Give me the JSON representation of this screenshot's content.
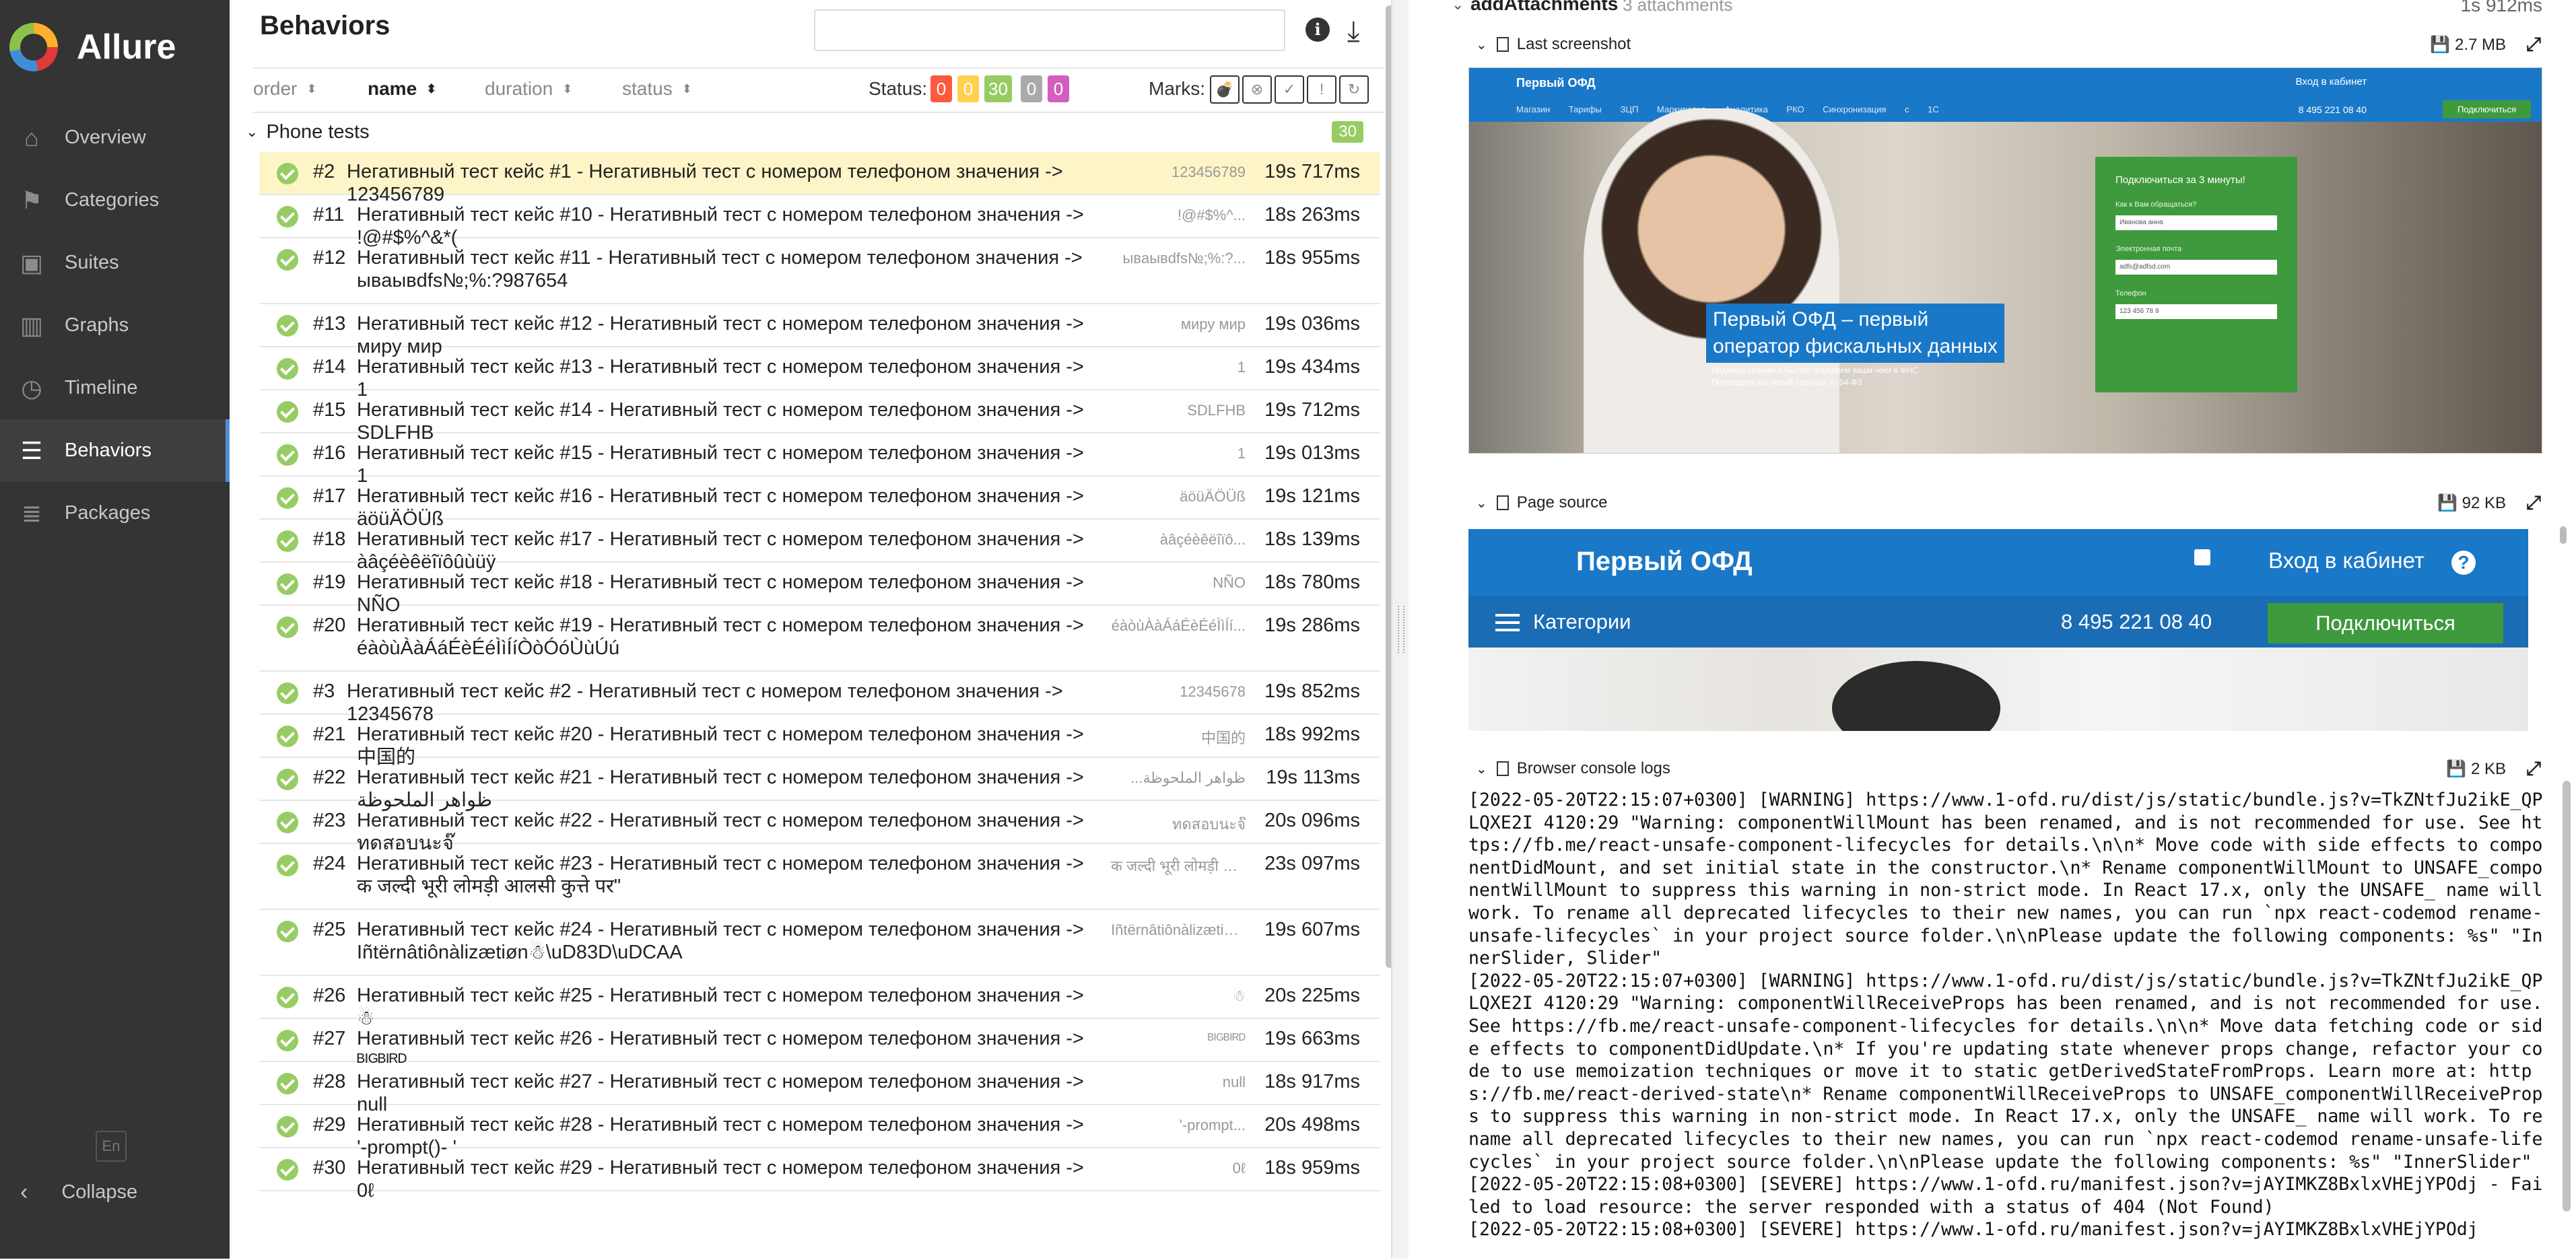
{
  "app": {
    "name": "Allure"
  },
  "sidebar": {
    "items": [
      {
        "label": "Overview",
        "icon": "home-icon"
      },
      {
        "label": "Categories",
        "icon": "flag-icon"
      },
      {
        "label": "Suites",
        "icon": "briefcase-icon"
      },
      {
        "label": "Graphs",
        "icon": "bar-chart-icon"
      },
      {
        "label": "Timeline",
        "icon": "clock-icon"
      },
      {
        "label": "Behaviors",
        "icon": "list-icon",
        "active": true
      },
      {
        "label": "Packages",
        "icon": "stack-icon"
      }
    ],
    "lang": "En",
    "collapse": "Collapse"
  },
  "tree": {
    "title": "Behaviors",
    "search_placeholder": "",
    "sort": [
      "order",
      "name",
      "duration",
      "status"
    ],
    "status_label": "Status:",
    "status_counts": [
      {
        "value": "0",
        "color": "#fd5a3e"
      },
      {
        "value": "0",
        "color": "#ffd050"
      },
      {
        "value": "30",
        "color": "#97cc64"
      },
      {
        "value": "0",
        "color": "#aaaaaa"
      },
      {
        "value": "0",
        "color": "#d35ebe"
      }
    ],
    "marks_label": "Marks:",
    "group": {
      "name": "Phone tests",
      "count": "30"
    },
    "rows": [
      {
        "num": "#2",
        "name": "Негативный тест кейс #1 - Негативный тест с номером телефоном значения -> 123456789",
        "param": "123456789",
        "dur": "19s 717ms",
        "selected": true
      },
      {
        "num": "#11",
        "name": "Негативный тест кейс #10 - Негативный тест с номером телефоном значения -> !@#$%^&*(",
        "param": "!@#$%^...",
        "dur": "18s 263ms"
      },
      {
        "num": "#12",
        "name": "Негативный тест кейс #11 - Негативный тест с номером телефоном значения -> ывaывdfs№;%:?987654",
        "param": "ывaывdfs№;%:?...",
        "dur": "18s 955ms"
      },
      {
        "num": "#13",
        "name": "Негативный тест кейс #12 - Негативный тест с номером телефоном значения -> миру мир",
        "param": "миру мир",
        "dur": "19s 036ms"
      },
      {
        "num": "#14",
        "name": "Негативный тест кейс #13 - Негативный тест с номером телефоном значения -> 1",
        "param": "1",
        "dur": "19s 434ms"
      },
      {
        "num": "#15",
        "name": "Негативный тест кейс #14 - Негативный тест с номером телефоном значения -> SDLFHB",
        "param": "SDLFHB",
        "dur": "19s 712ms"
      },
      {
        "num": "#16",
        "name": "Негативный тест кейс #15 - Негативный тест с номером телефоном значения -> 1",
        "param": "1",
        "dur": "19s 013ms"
      },
      {
        "num": "#17",
        "name": "Негативный тест кейс #16 - Негативный тест с номером телефоном значения -> äöüÄÖÜß",
        "param": "äöüÄÖÜß",
        "dur": "19s 121ms"
      },
      {
        "num": "#18",
        "name": "Негативный тест кейс #17 - Негативный тест с номером телефоном значения -> àâçéèêëîïôûùüÿ",
        "param": "àâçéèêëîïô...",
        "dur": "18s 139ms"
      },
      {
        "num": "#19",
        "name": "Негативный тест кейс #18 - Негативный тест с номером телефоном значения -> NÑO",
        "param": "NÑO",
        "dur": "18s 780ms"
      },
      {
        "num": "#20",
        "name": "Негативный тест кейс #19 - Негативный тест с номером телефоном значения -> éàòùÀàÁáÉèÉéÌìÍíÒòÓóÙùÚú",
        "param": "éàòùÀàÁáÉèÉéÌìÍí...",
        "dur": "19s 286ms"
      },
      {
        "num": "#3",
        "name": "Негативный тест кейс #2 - Негативный тест с номером телефоном значения -> 12345678",
        "param": "12345678",
        "dur": "19s 852ms"
      },
      {
        "num": "#21",
        "name": "Негативный тест кейс #20 - Негативный тест с номером телефоном значения -> 中国的",
        "param": "中国的",
        "dur": "18s 992ms"
      },
      {
        "num": "#22",
        "name": "Негативный тест кейс #21 - Негативный тест с номером телефоном значения -> ظواهر الملحوظة",
        "param": "...ظواهر الملحوظة",
        "dur": "19s 113ms"
      },
      {
        "num": "#23",
        "name": "Негативный тест кейс #22 - Негативный тест с номером телефоном значения -> ทดสอบนะจ๊",
        "param": "ทดสอบนะจ๊",
        "dur": "20s 096ms"
      },
      {
        "num": "#24",
        "name": "Негативный тест кейс #23 - Негативный тест с номером телефоном значения -> क जल्दी भूरी लोमड़ी आलसी कुत्ते पर\"",
        "param": "क जल्दी भूरी लोमड़ी आ...",
        "dur": "23s 097ms"
      },
      {
        "num": "#25",
        "name": "Негативный тест кейс #24 - Негативный тест с номером телефоном значения -> Iñtërnâtiônàlizætiøn☃\\uD83D\\uDCAA",
        "param": "Iñtërnâtiônàlizætiøn☃\\...",
        "dur": "19s 607ms"
      },
      {
        "num": "#26",
        "name": "Негативный тест кейс #25 - Негативный тест с номером телефоном значения -> ☃",
        "param": "☃",
        "dur": "20s 225ms"
      },
      {
        "num": "#27",
        "name": "Негативный тест кейс #26 - Негативный тест с номером телефоном значения -> ᴮᴵᴳᴮᴵᴿᴰ",
        "param": "ᴮᴵᴳᴮᴵᴿᴰ",
        "dur": "19s 663ms"
      },
      {
        "num": "#28",
        "name": "Негативный тест кейс #27 - Негативный тест с номером телефоном значения -> null",
        "param": "null",
        "dur": "18s 917ms"
      },
      {
        "num": "#29",
        "name": "Негативный тест кейс #28 - Негативный тест с номером телефоном значения -> '-prompt()- '",
        "param": "'-prompt...",
        "dur": "20s 498ms"
      },
      {
        "num": "#30",
        "name": "Негативный тест кейс #29 - Негативный тест с номером телефоном значения -> 0ℓ",
        "param": "0ℓ",
        "dur": "18s 959ms"
      }
    ]
  },
  "detail": {
    "step_title": "addAttachments",
    "step_count": "3 attachments",
    "step_time": "1s 912ms",
    "attachments": [
      {
        "name": "Last screenshot",
        "size": "2.7 MB"
      },
      {
        "name": "Page source",
        "size": "92 KB"
      },
      {
        "name": "Browser console logs",
        "size": "2 KB"
      }
    ],
    "screenshot": {
      "brand": "Первый ОФД",
      "login": "Вход в кабинет",
      "menu": "Магазин Тарифы ЗЦП Маркировка Аналитика РКО Синхронизация с 1С",
      "phone": "8 495 221 08 40",
      "connect": "Подключиться",
      "hero_line1": "Первый ОФД – первый",
      "hero_line2": "оператор фискальных данных",
      "sub_line1": "Надежно храним и быстро передаем ваши чеки в ФНС.",
      "sub_line2": "Переходите на новый порядок по 54-ФЗ",
      "form_title": "Подключиться за 3 минуты!",
      "form_q1": "Как к Вам обращаться?",
      "form_v1": "Иванова анна",
      "form_q2": "Электронная почта",
      "form_v2": "adfs@adfsd.com",
      "form_q3": "Телефон",
      "form_v3": "123 456 78 9"
    },
    "source": {
      "brand": "Первый ОФД",
      "login": "Вход в кабинет",
      "help": "?",
      "categories": "Категории",
      "phone": "8 495 221 08 40",
      "connect": "Подключиться"
    },
    "console_log": "[2022-05-20T22:15:07+0300] [WARNING] https://www.1-ofd.ru/dist/js/static/bundle.js?v=TkZNtfJu2ikE_QPLQXE2I 4120:29 \"Warning: componentWillMount has been renamed, and is not recommended for use. See https://fb.me/react-unsafe-component-lifecycles for details.\\n\\n* Move code with side effects to componentDidMount, and set initial state in the constructor.\\n* Rename componentWillMount to UNSAFE_componentWillMount to suppress this warning in non-strict mode. In React 17.x, only the UNSAFE_ name will work. To rename all deprecated lifecycles to their new names, you can run `npx react-codemod rename-unsafe-lifecycles` in your project source folder.\\n\\nPlease update the following components: %s\" \"InnerSlider, Slider\"\n[2022-05-20T22:15:07+0300] [WARNING] https://www.1-ofd.ru/dist/js/static/bundle.js?v=TkZNtfJu2ikE_QPLQXE2I 4120:29 \"Warning: componentWillReceiveProps has been renamed, and is not recommended for use. See https://fb.me/react-unsafe-component-lifecycles for details.\\n\\n* Move data fetching code or side effects to componentDidUpdate.\\n* If you're updating state whenever props change, refactor your code to use memoization techniques or move it to static getDerivedStateFromProps. Learn more at: https://fb.me/react-derived-state\\n* Rename componentWillReceiveProps to UNSAFE_componentWillReceiveProps to suppress this warning in non-strict mode. In React 17.x, only the UNSAFE_ name will work. To rename all deprecated lifecycles to their new names, you can run `npx react-codemod rename-unsafe-lifecycles` in your project source folder.\\n\\nPlease update the following components: %s\" \"InnerSlider\"\n[2022-05-20T22:15:08+0300] [SEVERE] https://www.1-ofd.ru/manifest.json?v=jAYIMKZ8BxlxVHEjYPOdj - Failed to load resource: the server responded with a status of 404 (Not Found)\n[2022-05-20T22:15:08+0300] [SEVERE] https://www.1-ofd.ru/manifest.json?v=jAYIMKZ8BxlxVHEjYPOdj"
  }
}
